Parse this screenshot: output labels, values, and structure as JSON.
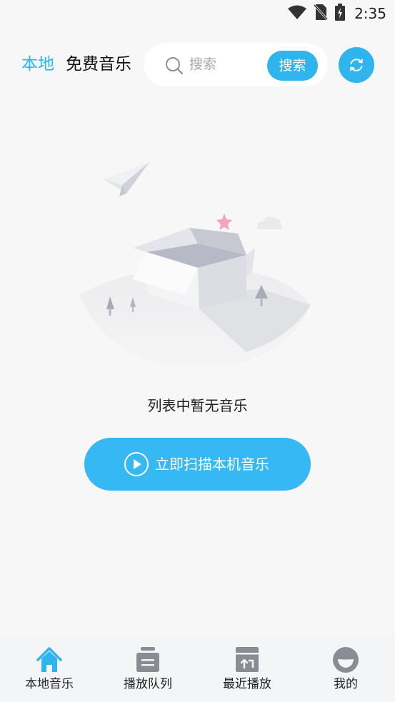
{
  "status_bar": {
    "time": "2:35"
  },
  "header": {
    "tabs": [
      {
        "label": "本地",
        "active": true
      },
      {
        "label": "免费音乐",
        "active": false
      }
    ],
    "search": {
      "placeholder": "搜索",
      "button_label": "搜索"
    },
    "refresh_icon": "refresh-icon"
  },
  "main": {
    "empty_message": "列表中暂无音乐",
    "scan_button_label": "立即扫描本机音乐"
  },
  "bottom_nav": {
    "items": [
      {
        "label": "本地音乐",
        "icon": "home-icon",
        "active": true
      },
      {
        "label": "播放队列",
        "icon": "queue-icon",
        "active": false
      },
      {
        "label": "最近播放",
        "icon": "recent-icon",
        "active": false
      },
      {
        "label": "我的",
        "icon": "profile-icon",
        "active": false
      }
    ]
  },
  "colors": {
    "accent": "#2fb4ee",
    "background": "#f7f7f7",
    "nav_background": "#f3f5f6",
    "icon_gray": "#8a8c94"
  }
}
